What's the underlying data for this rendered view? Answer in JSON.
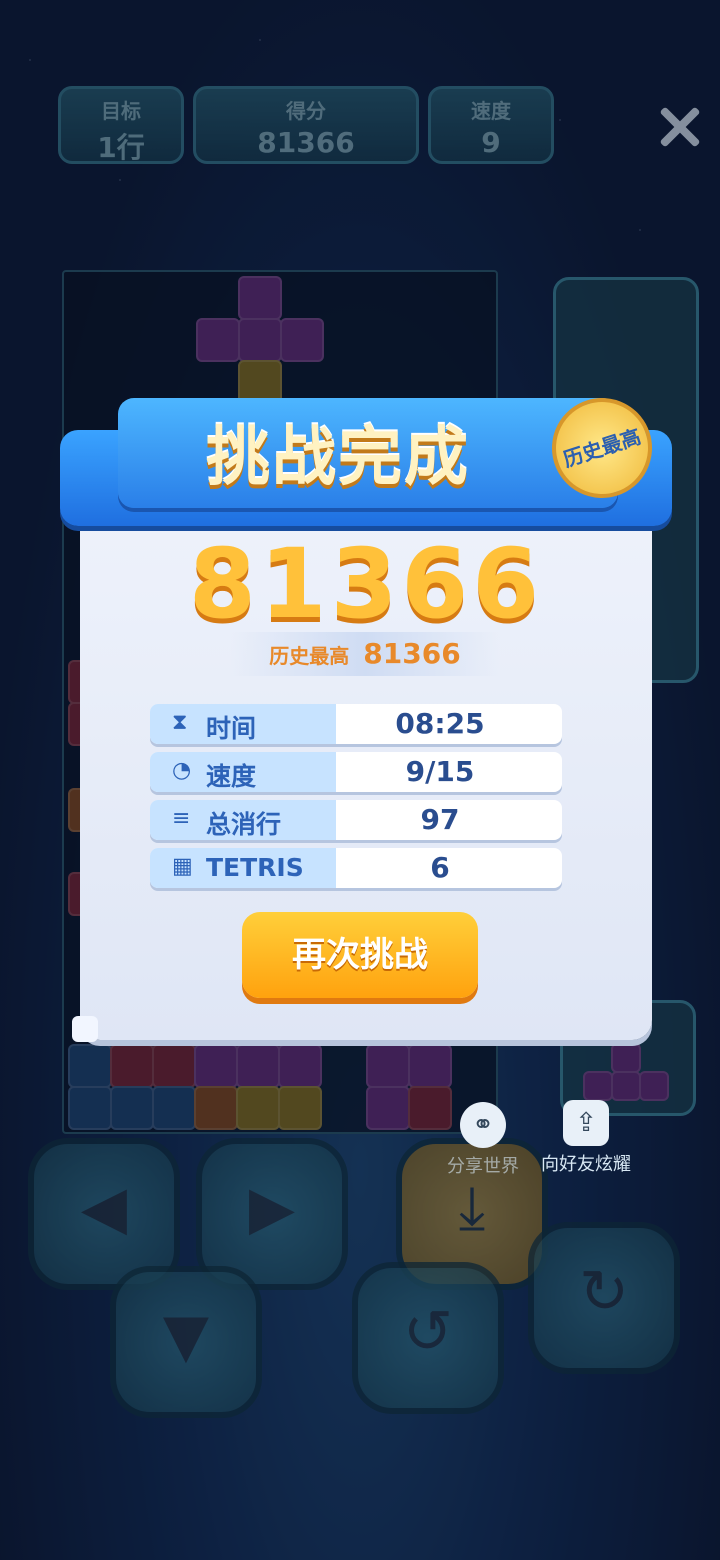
{
  "hud": {
    "target_label": "目标",
    "target_value": "1行",
    "score_label": "得分",
    "score_value": "81366",
    "speed_label": "速度",
    "speed_value": "9"
  },
  "modal": {
    "title": "挑战完成",
    "stamp": "历史最高",
    "score": "81366",
    "best_label": "历史最高",
    "best_value": "81366",
    "stats": [
      {
        "icon": "hourglass-icon",
        "name": "时间",
        "value": "08:25"
      },
      {
        "icon": "speedometer-icon",
        "name": "速度",
        "value": "9/15"
      },
      {
        "icon": "lines-icon",
        "name": "总消行",
        "value": "97"
      },
      {
        "icon": "grid-icon",
        "name": "TETRIS",
        "value": "6"
      }
    ],
    "retry_label": "再次挑战"
  },
  "share": {
    "world_label": "分享世界",
    "friends_label": "向好友炫耀"
  },
  "colors": {
    "accent": "#ffa20e",
    "ribbon": "#2a7fe8",
    "score": "#ffc13a"
  }
}
